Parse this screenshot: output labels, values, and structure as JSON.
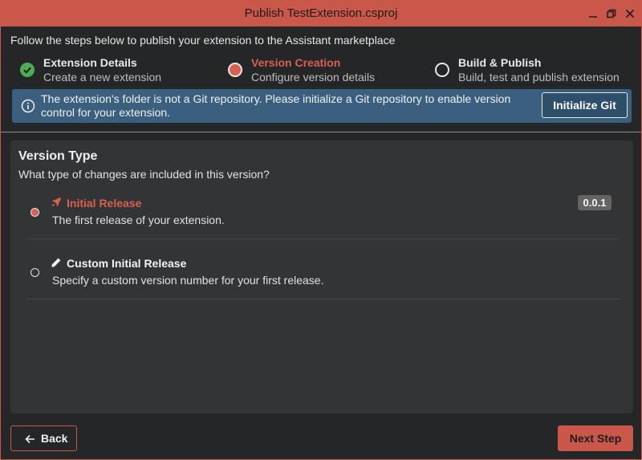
{
  "window": {
    "title": "Publish TestExtension.csproj",
    "controls": [
      "minimize-icon",
      "maximize-icon",
      "close-icon"
    ]
  },
  "intro": "Follow the steps below to publish your extension to the Assistant marketplace",
  "steps": [
    {
      "title": "Extension Details",
      "subtitle": "Create a new extension",
      "state": "completed",
      "icon": "check-icon"
    },
    {
      "title": "Version Creation",
      "subtitle": "Configure version details",
      "state": "active",
      "icon": "active-step-icon"
    },
    {
      "title": "Build & Publish",
      "subtitle": "Build, test and publish extension",
      "state": "pending",
      "icon": "pending-step-icon"
    }
  ],
  "info_bar": {
    "icon": "info-icon",
    "message": "The extension's folder is not a Git repository. Please initialize a Git repository to enable version control for your extension.",
    "button_label": "Initialize Git"
  },
  "version_type": {
    "title": "Version Type",
    "subtitle": "What type of changes are included in this version?",
    "options": [
      {
        "title": "Initial Release",
        "description": "The first release of your extension.",
        "icon": "rocket-icon",
        "badge": "0.0.1",
        "selected": true
      },
      {
        "title": "Custom Initial Release",
        "description": "Specify a custom version number for your first release.",
        "icon": "pencil-icon",
        "selected": false
      }
    ]
  },
  "footer": {
    "back_label": "Back",
    "next_label": "Next Step"
  },
  "colors": {
    "accent": "#c9574a",
    "success": "#4cae4f",
    "info_bar": "#3a5f7f",
    "panel": "#333436",
    "background": "#252628"
  }
}
